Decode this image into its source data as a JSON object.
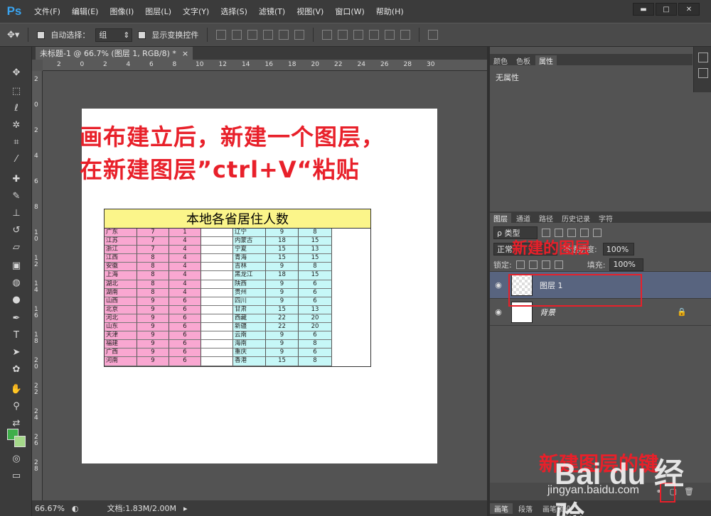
{
  "app": {
    "logo": "Ps"
  },
  "menu": [
    "文件(F)",
    "编辑(E)",
    "图像(I)",
    "图层(L)",
    "文字(Y)",
    "选择(S)",
    "滤镜(T)",
    "视图(V)",
    "窗口(W)",
    "帮助(H)"
  ],
  "window_controls": {
    "minimize": "▬",
    "maximize": "□",
    "close": "✕"
  },
  "options": {
    "auto_select_label": "自动选择：",
    "auto_select_value": "组",
    "show_transform_label": "显示变换控件"
  },
  "document": {
    "tab_title": "未标题-1 @ 66.7% (图层 1, RGB/8) *",
    "tab_close": "×",
    "ruler_h": [
      "2",
      "0",
      "2",
      "4",
      "6",
      "8",
      "10",
      "12",
      "14",
      "16",
      "18",
      "20",
      "22",
      "24",
      "26",
      "28",
      "30"
    ],
    "ruler_v": [
      "2",
      "0",
      "2",
      "4",
      "6",
      "8",
      "1\n0",
      "1\n2",
      "1\n4",
      "1\n6",
      "1\n8",
      "2\n0",
      "2\n2",
      "2\n4",
      "2\n6",
      "2\n8"
    ]
  },
  "annotations": {
    "line1": "画布建立后，新建一个图层，",
    "line2": "在新建图层”ctrl+V“粘贴",
    "new_layer_label": "新建的图层",
    "new_layer_button_label": "新建图层的键"
  },
  "table": {
    "title": "本地各省居住人数",
    "rows": [
      [
        "广东",
        "7",
        "1",
        "辽宁",
        "9",
        "8"
      ],
      [
        "江苏",
        "7",
        "4",
        "内蒙古",
        "18",
        "15"
      ],
      [
        "浙江",
        "7",
        "4",
        "宁夏",
        "15",
        "13"
      ],
      [
        "江西",
        "8",
        "4",
        "青海",
        "15",
        "15"
      ],
      [
        "安徽",
        "8",
        "4",
        "吉林",
        "9",
        "8"
      ],
      [
        "上海",
        "8",
        "4",
        "黑龙江",
        "18",
        "15"
      ],
      [
        "湖北",
        "8",
        "4",
        "陕西",
        "9",
        "6"
      ],
      [
        "湖南",
        "8",
        "4",
        "贵州",
        "9",
        "6"
      ],
      [
        "山西",
        "9",
        "6",
        "四川",
        "9",
        "6"
      ],
      [
        "北京",
        "9",
        "6",
        "甘肃",
        "15",
        "13"
      ],
      [
        "河北",
        "9",
        "6",
        "西藏",
        "22",
        "20"
      ],
      [
        "山东",
        "9",
        "6",
        "新疆",
        "22",
        "20"
      ],
      [
        "天津",
        "9",
        "6",
        "云南",
        "9",
        "6"
      ],
      [
        "福建",
        "9",
        "6",
        "海南",
        "9",
        "8"
      ],
      [
        "广西",
        "9",
        "6",
        "重庆",
        "9",
        "6"
      ],
      [
        "河南",
        "9",
        "6",
        "香港",
        "15",
        "8"
      ]
    ]
  },
  "status": {
    "zoom": "66.67%",
    "doc_size": "文档:1.83M/2.00M"
  },
  "props_panel": {
    "tabs": [
      "颜色",
      "色板",
      "属性"
    ],
    "active_tab": "属性",
    "body": "无属性"
  },
  "layers_panel": {
    "tabs": [
      "图层",
      "通道",
      "路径",
      "历史记录",
      "字符"
    ],
    "filter_label": "ρ 类型",
    "blend_mode": "正常",
    "opacity_label": "不透明度:",
    "opacity_value": "100%",
    "lock_label": "锁定:",
    "fill_label": "填充:",
    "fill_value": "100%",
    "layers": [
      {
        "name": "图层 1",
        "selected": true
      },
      {
        "name": "背景",
        "selected": false,
        "locked": true
      }
    ]
  },
  "bottom_tabs": [
    "画笔",
    "段落",
    "画笔预设"
  ],
  "watermark": {
    "logo": "Bai du 经验",
    "url": "jingyan.baidu.com"
  },
  "colors": {
    "annotation": "#e8202a",
    "selected_layer": "#58647f",
    "table_pink": "#f9a7d1",
    "table_cyan": "#c6f7f7",
    "table_title": "#fbf58a"
  }
}
